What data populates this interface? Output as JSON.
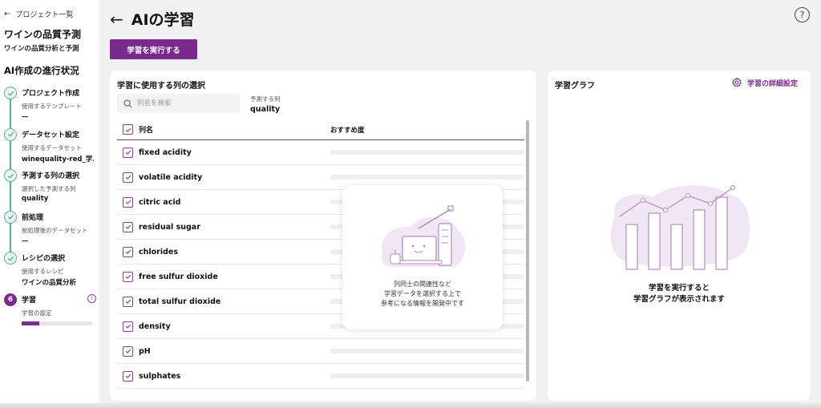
{
  "sidebar": {
    "back_label": "プロジェクト一覧",
    "project_title": "ワインの品質予測",
    "project_subtitle": "ワインの品質分析と予測",
    "progress_title": "AI作成の進行状況",
    "steps": [
      {
        "title": "プロジェクト作成",
        "caption": "使用するテンプレート",
        "value": "ー"
      },
      {
        "title": "データセット設定",
        "caption": "使用するデータセット",
        "value": "winequality-red_学..."
      },
      {
        "title": "予測する列の選択",
        "caption": "選択した予測する列",
        "value": "quality"
      },
      {
        "title": "前処理",
        "caption": "前処理後のデータセット",
        "value": "ー"
      },
      {
        "title": "レシピの選択",
        "caption": "使用するレシピ",
        "value": "ワインの品質分析"
      }
    ],
    "active_step": {
      "number": "6",
      "title": "学習",
      "caption": "学習の設定",
      "progress": 0.25
    }
  },
  "header": {
    "title": "AIの学習",
    "run_button": "学習を実行する",
    "help": "?"
  },
  "column_panel": {
    "title": "学習に使用する列の選択",
    "search_placeholder": "列名を検索",
    "target_label": "予測する列",
    "target_value": "quality",
    "header_name": "列名",
    "header_rec": "おすすめ度",
    "columns": [
      "fixed acidity",
      "volatile acidity",
      "citric acid",
      "residual sugar",
      "chlorides",
      "free sulfur dioxide",
      "total sulfur dioxide",
      "density",
      "pH",
      "sulphates"
    ],
    "overlay_text": [
      "列同士の関連性など",
      "学習データを選択する上で",
      "参考になる情報を開発中です"
    ]
  },
  "graph_panel": {
    "title": "学習グラフ",
    "settings_label": "学習の詳細設定",
    "message": [
      "学習を実行すると",
      "学習グラフが表示されます"
    ]
  },
  "colors": {
    "accent": "#7a2a8c",
    "step_done": "#58b19a",
    "illustration": "#f1e6f4"
  }
}
